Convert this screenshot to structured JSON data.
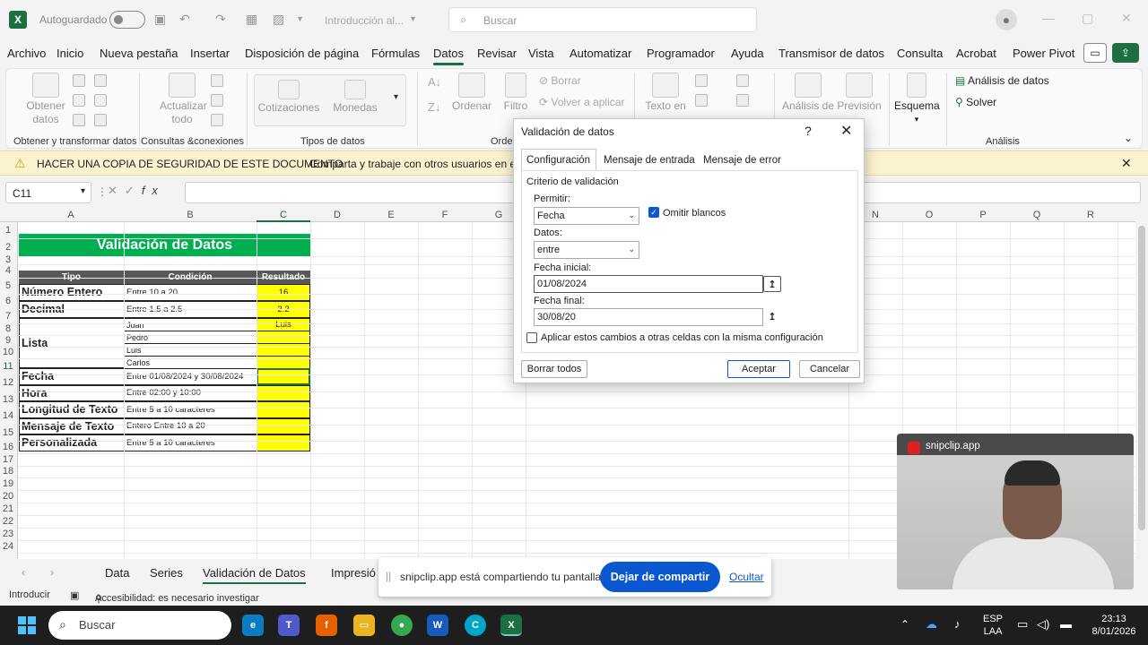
{
  "titlebar": {
    "autosave_label": "Autoguardado",
    "doc_title": "Introducción al...",
    "search_placeholder": "Buscar"
  },
  "menu": [
    "Archivo",
    "Inicio",
    "Nueva pestaña",
    "Insertar",
    "Disposición de página",
    "Fórmulas",
    "Datos",
    "Revisar",
    "Vista",
    "Automatizar",
    "Programador",
    "Ayuda",
    "Transmisor de datos",
    "Consulta",
    "Acrobat",
    "Power Pivot"
  ],
  "menu_active": "Datos",
  "ribbon": {
    "obtener_datos": "Obtener datos",
    "actualizar_todo": "Actualizar todo",
    "cotizaciones": "Cotizaciones",
    "monedas": "Monedas",
    "ordenar": "Ordenar",
    "filtro": "Filtro",
    "borrar": "Borrar",
    "volver_aplicar": "Volver a aplicar",
    "texto_en": "Texto en",
    "analisis_de": "Análisis de",
    "prevision": "Previsión",
    "esquema": "Esquema",
    "analisis_datos": "Análisis de datos",
    "solver": "Solver",
    "groups": {
      "g1": "Obtener y transformar datos",
      "g2": "Consultas &conexiones",
      "g3": "Tipos de datos",
      "g4": "Orde",
      "g5": "Análisis"
    }
  },
  "notification": {
    "bold": "HACER UNA COPIA DE SEGURIDAD DE ESTE DOCUMENTO",
    "message": "Comparta y trabaje con otros usuarios en este"
  },
  "formula_bar": {
    "name_box": "C11",
    "fx": "fx"
  },
  "columns": [
    "A",
    "B",
    "C",
    "D",
    "E",
    "F",
    "G",
    "N",
    "O",
    "P",
    "Q",
    "R"
  ],
  "rows": [
    "1",
    "2",
    "3",
    "4",
    "5",
    "6",
    "7",
    "8",
    "9",
    "10",
    "11",
    "12",
    "13",
    "14",
    "15",
    "16",
    "17",
    "18",
    "19",
    "20",
    "21",
    "22",
    "23",
    "24"
  ],
  "table": {
    "title": "Validación de Datos",
    "headers": {
      "tipo": "Tipo",
      "condicion": "Condición",
      "resultado": "Resultado"
    },
    "rows": [
      {
        "tipo": "Número Entero",
        "condicion": "Entre 10 a 20",
        "resultado": "16"
      },
      {
        "tipo": "Decimal",
        "condicion": "Entre 1.5 a 2.5",
        "resultado": "2.2"
      },
      {
        "tipo": "Lista",
        "list": [
          "Juan",
          "Pedro",
          "Luis",
          "Carlos"
        ],
        "resultado": "Luis"
      },
      {
        "tipo": "Fecha",
        "condicion": "Entre 01/08/2024 y 30/08/2024",
        "resultado": ""
      },
      {
        "tipo": "Hora",
        "condicion": "Entre 02:00 y 10:00",
        "resultado": ""
      },
      {
        "tipo": "Longitud de Texto",
        "condicion": "Entre 5 a 10 caracteres",
        "resultado": ""
      },
      {
        "tipo": "Mensaje de Texto",
        "condicion": "Entero Entre 10 a 20",
        "resultado": ""
      },
      {
        "tipo": "Personalizada",
        "condicion": "Entre 5 a 10 caracteres",
        "resultado": ""
      }
    ]
  },
  "dialog": {
    "title": "Validación de datos",
    "help": "?",
    "tabs": [
      "Configuración",
      "Mensaje de entrada",
      "Mensaje de error"
    ],
    "criteria_label": "Criterio de validación",
    "permitir_label": "Permitir:",
    "permitir_value": "Fecha",
    "omitir_label": "Omitir blancos",
    "datos_label": "Datos:",
    "datos_value": "entre",
    "fecha_inicial_label": "Fecha inicial:",
    "fecha_inicial_value": "01/08/2024",
    "fecha_final_label": "Fecha final:",
    "fecha_final_value": "30/08/20",
    "apply_label": "Aplicar estos cambios a otras celdas con la misma configuración",
    "clear_all": "Borrar todos",
    "accept": "Aceptar",
    "cancel": "Cancelar"
  },
  "sheets": [
    "Data",
    "Series",
    "Validación de Datos",
    "Impresió"
  ],
  "sheet_active": "Validación de Datos",
  "status": {
    "mode": "Introducir",
    "accessibility": "Accesibilidad: es necesario investigar"
  },
  "sharebar": {
    "message": "snipclip.app está compartiendo tu pantalla.",
    "stop": "Dejar de compartir",
    "hide": "Ocultar"
  },
  "webcam": {
    "label": "snipclip.app"
  },
  "taskbar": {
    "search": "Buscar",
    "lang1": "ESP",
    "lang2": "LAA",
    "time": "23:13",
    "date": "8/01/2026"
  }
}
